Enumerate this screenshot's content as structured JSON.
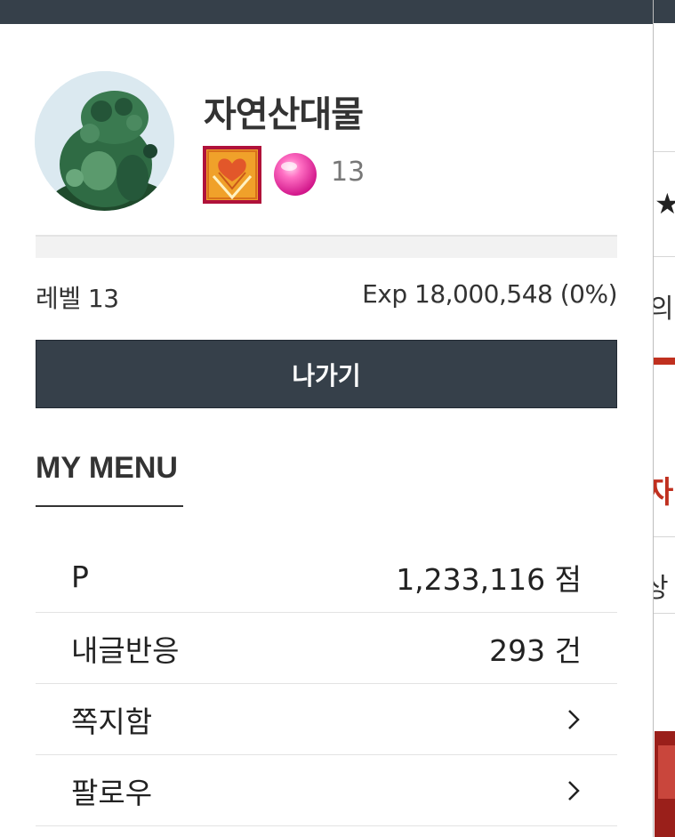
{
  "profile": {
    "username": "자연산대물",
    "level_number": "13",
    "level_label": "레벨 13",
    "exp_text": "Exp 18,000,548 (0%)",
    "exp_progress": 0
  },
  "actions": {
    "exit_label": "나가기"
  },
  "menu": {
    "title": "MY MENU",
    "items": [
      {
        "label": "P",
        "value": "1,233,116 점"
      },
      {
        "label": "내글반응",
        "value": "293 건"
      },
      {
        "label": "쪽지함",
        "icon": "chevron-right-icon"
      },
      {
        "label": "팔로우",
        "icon": "chevron-right-icon"
      }
    ]
  },
  "background_page": {
    "fragments": [
      "★",
      "의",
      "자",
      "상"
    ]
  },
  "colors": {
    "primary_dark": "#36404a",
    "accent_red": "#c0301f",
    "text": "#222222",
    "muted": "#777777",
    "divider": "#e3e3e3"
  },
  "icons": {
    "badge": "heart-badge-icon",
    "gem": "pink-gem-icon"
  }
}
